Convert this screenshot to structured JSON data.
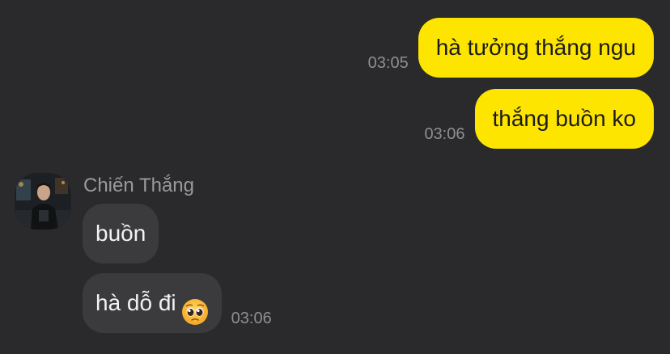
{
  "messages": {
    "outgoing": [
      {
        "text": "hà tưởng thắng ngu",
        "time": "03:05"
      },
      {
        "text": "thắng buồn ko",
        "time": "03:06"
      }
    ],
    "incoming_sender": "Chiến Thắng",
    "incoming": [
      {
        "text": "buồn"
      },
      {
        "text": "hà dỗ đi",
        "emoji": "pleading-face",
        "time": "03:06"
      }
    ]
  },
  "colors": {
    "background": "#2a2a2c",
    "outgoing_bubble": "#fee500",
    "incoming_bubble": "#3b3b3d"
  }
}
